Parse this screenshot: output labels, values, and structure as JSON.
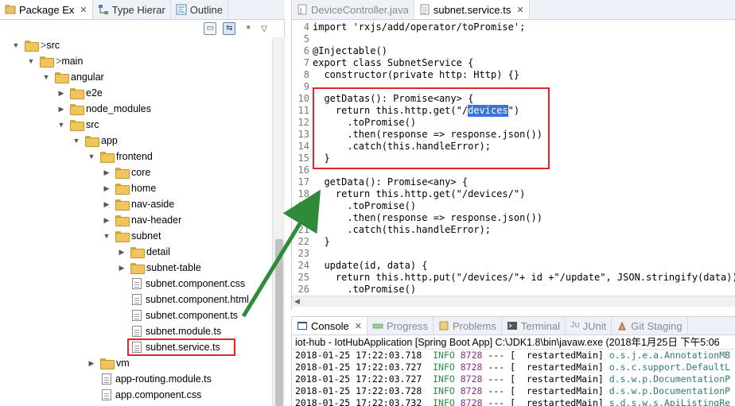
{
  "left_tabs": [
    {
      "label": "Package Ex",
      "icon": "package-explorer-icon",
      "active": true
    },
    {
      "label": "Type Hierar",
      "icon": "type-hierarchy-icon",
      "active": false
    },
    {
      "label": "Outline",
      "icon": "outline-icon",
      "active": false
    }
  ],
  "tree": [
    {
      "label": "src",
      "depth": 1,
      "type": "folder",
      "expanded": true,
      "prefix": "> "
    },
    {
      "label": "main",
      "depth": 2,
      "type": "folder",
      "expanded": true,
      "prefix": "> "
    },
    {
      "label": "angular",
      "depth": 3,
      "type": "folder",
      "expanded": true
    },
    {
      "label": "e2e",
      "depth": 4,
      "type": "folder",
      "expanded": false
    },
    {
      "label": "node_modules",
      "depth": 4,
      "type": "folder",
      "expanded": false
    },
    {
      "label": "src",
      "depth": 4,
      "type": "folder",
      "expanded": true
    },
    {
      "label": "app",
      "depth": 5,
      "type": "folder",
      "expanded": true
    },
    {
      "label": "frontend",
      "depth": 6,
      "type": "folder",
      "expanded": true
    },
    {
      "label": "core",
      "depth": 7,
      "type": "folder",
      "expanded": false
    },
    {
      "label": "home",
      "depth": 7,
      "type": "folder",
      "expanded": false
    },
    {
      "label": "nav-aside",
      "depth": 7,
      "type": "folder",
      "expanded": false
    },
    {
      "label": "nav-header",
      "depth": 7,
      "type": "folder",
      "expanded": false
    },
    {
      "label": "subnet",
      "depth": 7,
      "type": "folder",
      "expanded": true
    },
    {
      "label": "detail",
      "depth": 8,
      "type": "folder",
      "expanded": false
    },
    {
      "label": "subnet-table",
      "depth": 8,
      "type": "folder",
      "expanded": false
    },
    {
      "label": "subnet.component.css",
      "depth": 8,
      "type": "file"
    },
    {
      "label": "subnet.component.html",
      "depth": 8,
      "type": "file"
    },
    {
      "label": "subnet.component.ts",
      "depth": 8,
      "type": "file"
    },
    {
      "label": "subnet.module.ts",
      "depth": 8,
      "type": "file"
    },
    {
      "label": "subnet.service.ts",
      "depth": 8,
      "type": "file",
      "highlighted": true
    },
    {
      "label": "vm",
      "depth": 6,
      "type": "folder",
      "expanded": false
    },
    {
      "label": "app-routing.module.ts",
      "depth": 6,
      "type": "file"
    },
    {
      "label": "app.component.css",
      "depth": 6,
      "type": "file"
    }
  ],
  "editor_tabs": [
    {
      "label": "DeviceController.java",
      "icon": "java-file-icon",
      "active": false
    },
    {
      "label": "subnet.service.ts",
      "icon": "ts-file-icon",
      "active": true
    }
  ],
  "code_lines": [
    {
      "num": "4",
      "text": "import 'rxjs/add/operator/toPromise';"
    },
    {
      "num": "5",
      "text": ""
    },
    {
      "num": "6",
      "text": "@Injectable()"
    },
    {
      "num": "7",
      "text": "export class SubnetService {"
    },
    {
      "num": "8",
      "text": "  constructor(private http: Http) {}"
    },
    {
      "num": "9",
      "text": ""
    },
    {
      "num": "10",
      "text": "  getDatas(): Promise<any> {"
    },
    {
      "num": "11",
      "text": "    return this.http.get(\"/",
      "selected": "devices",
      "after": "\")"
    },
    {
      "num": "12",
      "text": "      .toPromise()"
    },
    {
      "num": "13",
      "text": "      .then(response => response.json())"
    },
    {
      "num": "14",
      "text": "      .catch(this.handleError);"
    },
    {
      "num": "15",
      "text": "  }"
    },
    {
      "num": "16",
      "text": ""
    },
    {
      "num": "17",
      "text": "  getData(): Promise<any> {"
    },
    {
      "num": "18",
      "text": "    return this.http.get(\"/devices/\")"
    },
    {
      "num": "19",
      "text": "      .toPromise()"
    },
    {
      "num": "20",
      "text": "      .then(response => response.json())"
    },
    {
      "num": "21",
      "text": "      .catch(this.handleError);"
    },
    {
      "num": "22",
      "text": "  }"
    },
    {
      "num": "23",
      "text": ""
    },
    {
      "num": "24",
      "text": "  update(id, data) {"
    },
    {
      "num": "25",
      "text": "    return this.http.put(\"/devices/\"+ id +\"/update\", JSON.stringify(data))"
    },
    {
      "num": "26",
      "text": "      .toPromise()"
    }
  ],
  "console_tabs": [
    {
      "label": "Console",
      "icon": "console-icon",
      "active": true,
      "closable": true
    },
    {
      "label": "Progress",
      "icon": "progress-icon",
      "active": false
    },
    {
      "label": "Problems",
      "icon": "problems-icon",
      "active": false
    },
    {
      "label": "Terminal",
      "icon": "terminal-icon",
      "active": false
    },
    {
      "label": "JUnit",
      "icon": "junit-icon",
      "active": false
    },
    {
      "label": "Git Staging",
      "icon": "git-staging-icon",
      "active": false
    }
  ],
  "console_title": "iot-hub - IotHubApplication [Spring Boot App] C:\\JDK1.8\\bin\\javaw.exe (2018年1月25日 下午5:06",
  "console_lines": [
    {
      "time": "2018-01-25 17:22:03.718",
      "level": "INFO",
      "pid": "8728",
      "sep": "---",
      "thread": "[  restartedMain]",
      "cls": "o.s.j.e.a.AnnotationMB"
    },
    {
      "time": "2018-01-25 17:22:03.727",
      "level": "INFO",
      "pid": "8728",
      "sep": "---",
      "thread": "[  restartedMain]",
      "cls": "o.s.c.support.DefaultL"
    },
    {
      "time": "2018-01-25 17:22:03.727",
      "level": "INFO",
      "pid": "8728",
      "sep": "---",
      "thread": "[  restartedMain]",
      "cls": "d.s.w.p.DocumentationP"
    },
    {
      "time": "2018-01-25 17:22:03.728",
      "level": "INFO",
      "pid": "8728",
      "sep": "---",
      "thread": "[  restartedMain]",
      "cls": "d.s.w.p.DocumentationP"
    },
    {
      "time": "2018-01-25 17:22:03.732",
      "level": "INFO",
      "pid": "8728",
      "sep": "---",
      "thread": "[  restartedMain]",
      "cls": "s.d.s.w.s.ApiListingRe"
    }
  ],
  "colors": {
    "highlight": "#e3242b",
    "arrow": "#2e8b3a",
    "selection": "#3875d7"
  }
}
